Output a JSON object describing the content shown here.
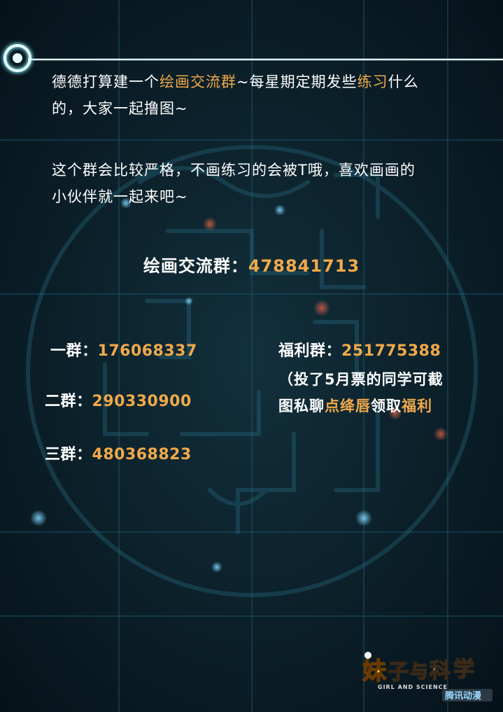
{
  "intro": {
    "line1_pre": "德德打算建一个",
    "line1_hl1": "绘画交流群",
    "line1_mid": "~每星期定期发些",
    "line1_hl2": "练习",
    "line1_post": "什么",
    "line2": "的，大家一起撸图~"
  },
  "rules": {
    "line1": "这个群会比较严格，不画练习的会被T哦，喜欢画画的",
    "line2": "小伙伴就一起来吧~"
  },
  "main_group": {
    "label": "绘画交流群：",
    "number": "478841713"
  },
  "groups": [
    {
      "label": "一群：",
      "number": "176068337"
    },
    {
      "label": "二群：",
      "number": "290330900"
    },
    {
      "label": "三群：",
      "number": "480368823"
    }
  ],
  "welfare_group": {
    "label": "福利群：",
    "number": "251775388"
  },
  "welfare_note": {
    "line1": "（投了5月票的同学可截",
    "line2_pre": "图私聊",
    "line2_hl1": "点绛唇",
    "line2_mid": "领取",
    "line2_hl2": "福利"
  },
  "logo": {
    "title": "妹子与科学",
    "subtitle": "GIRL AND SCIENCE",
    "publisher": "腾讯动漫"
  },
  "colors": {
    "background": "#0a1a24",
    "highlight": "#f0a94a",
    "circuit": "#1f6a85",
    "glow": "#bff6ff"
  }
}
